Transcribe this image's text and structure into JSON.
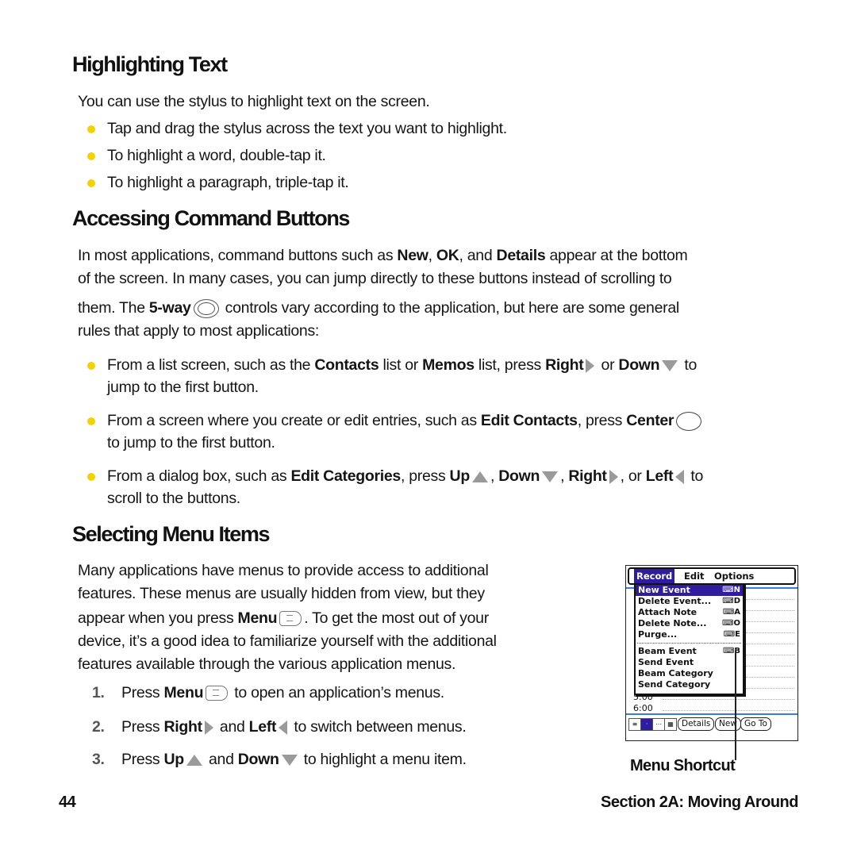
{
  "sections": {
    "highlighting": {
      "title": "Highlighting Text",
      "intro": "You can use the stylus to highlight text on the screen.",
      "bullets": [
        "Tap and drag the stylus across the text you want to highlight.",
        "To highlight a word, double-tap it.",
        "To highlight a paragraph, triple-tap it."
      ]
    },
    "command_buttons": {
      "title": "Accessing Command Buttons",
      "p1_a": "In most applications, command buttons such as ",
      "p1_new": "New",
      "p1_b": ", ",
      "p1_ok": "OK",
      "p1_c": ", and ",
      "p1_details": "Details",
      "p1_d": " appear at the bottom",
      "p2": "of the screen. In many cases, you can jump directly to these buttons instead of scrolling to",
      "p3_a": "them. The ",
      "p3_fiveway": "5-way",
      "p3_b": " controls vary according to the application, but here are some general",
      "p4": "rules that apply to most applications:",
      "b1": {
        "a": "From a list screen, such as the ",
        "contacts": "Contacts",
        "b": " list or ",
        "memos": "Memos",
        "c": " list, press ",
        "right": "Right",
        "d": " or ",
        "down": "Down",
        "e": " to",
        "f": "jump to the first button."
      },
      "b2": {
        "a": "From a screen where you create or edit entries, such as ",
        "edit_contacts": "Edit Contacts",
        "b": ", press ",
        "center": "Center",
        "c": "to jump to the first button."
      },
      "b3": {
        "a": "From a dialog box, such as ",
        "edit_categories": "Edit Categories",
        "b": ", press ",
        "up": "Up",
        "c": ", ",
        "down": "Down",
        "d": ", ",
        "right": "Right",
        "e": ", or ",
        "left": "Left",
        "f": " to",
        "g": "scroll to the buttons."
      }
    },
    "menu_items": {
      "title": "Selecting Menu Items",
      "p1": "Many applications have menus to provide access to additional",
      "p2": "features. These menus are usually hidden from view, but they",
      "p3_a": "appear when you press ",
      "p3_menu": "Menu",
      "p3_b": ". To get the most out of your",
      "p4": "device, it’s a good idea to familiarize yourself with the additional",
      "p5": "features available through the various application menus.",
      "steps": [
        {
          "num": "1.",
          "a": "Press ",
          "k1": "Menu",
          "b": " to open an application’s menus."
        },
        {
          "num": "2.",
          "a": "Press ",
          "k1": "Right",
          "b": " and ",
          "k2": "Left",
          "c": " to switch between menus."
        },
        {
          "num": "3.",
          "a": "Press ",
          "k1": "Up",
          "b": " and ",
          "k2": "Down",
          "c": " to highlight a menu item."
        }
      ]
    }
  },
  "device_screen": {
    "menubar": [
      "Record",
      "Edit",
      "Options"
    ],
    "menu_items": [
      {
        "label": "New Event",
        "shortcut": "N",
        "selected": true
      },
      {
        "label": "Delete Event...",
        "shortcut": "D"
      },
      {
        "label": "Attach Note",
        "shortcut": "A"
      },
      {
        "label": "Delete Note...",
        "shortcut": "O"
      },
      {
        "label": "Purge...",
        "shortcut": "E"
      },
      {
        "label": "Beam Event",
        "shortcut": "B"
      },
      {
        "label": "Send Event",
        "shortcut": ""
      },
      {
        "label": "Beam Category",
        "shortcut": ""
      },
      {
        "label": "Send Category",
        "shortcut": ""
      }
    ],
    "times": [
      "5:00",
      "6:00"
    ],
    "buttons": [
      "Details",
      "New",
      "Go To"
    ],
    "accent_color": "#2e1d9c",
    "callout": "Menu Shortcut"
  },
  "footer": {
    "page_number": "44",
    "section": "Section 2A: Moving Around"
  },
  "colors": {
    "bullet": "#f2d200",
    "arrow": "#9a9a9a"
  }
}
